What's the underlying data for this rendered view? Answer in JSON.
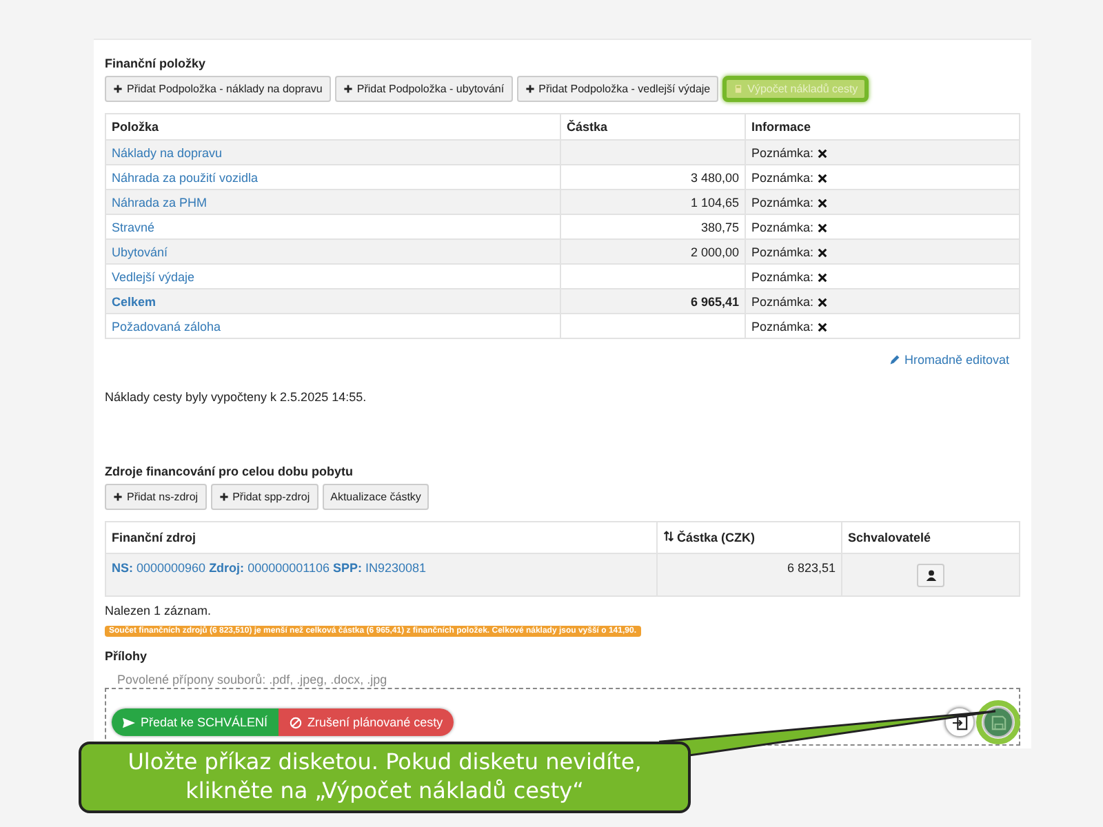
{
  "items_section": {
    "title": "Finanční položky",
    "buttons": [
      {
        "label": "Přidat Podpoložka - náklady na dopravu",
        "kind": "add",
        "highlighted": false
      },
      {
        "label": "Přidat Podpoložka - ubytování",
        "kind": "add",
        "highlighted": false
      },
      {
        "label": "Přidat Podpoložka - vedlejší výdaje",
        "kind": "add",
        "highlighted": false
      },
      {
        "label": "Výpočet nákladů cesty",
        "kind": "calculate",
        "highlighted": true
      }
    ],
    "table": {
      "columns": [
        "Položka",
        "Částka",
        "Informace"
      ],
      "rows": [
        {
          "item": "Náklady na dopravu",
          "amount": "",
          "info": "Poznámka:",
          "bold": false
        },
        {
          "item": "Náhrada za použití vozidla",
          "amount": "3 480,00",
          "info": "Poznámka:",
          "bold": false
        },
        {
          "item": "Náhrada za PHM",
          "amount": "1 104,65",
          "info": "Poznámka:",
          "bold": false
        },
        {
          "item": "Stravné",
          "amount": "380,75",
          "info": "Poznámka:",
          "bold": false
        },
        {
          "item": "Ubytování",
          "amount": "2 000,00",
          "info": "Poznámka:",
          "bold": false
        },
        {
          "item": "Vedlejší výdaje",
          "amount": "",
          "info": "Poznámka:",
          "bold": false
        },
        {
          "item": "Celkem",
          "amount": "6 965,41",
          "info": "Poznámka:",
          "bold": true
        },
        {
          "item": "Požadovaná záloha",
          "amount": "",
          "info": "Poznámka:",
          "bold": false
        }
      ]
    },
    "bulk_edit_link": "Hromadně editovat",
    "calc_note": "Náklady cesty byly vypočteny k 2.5.2025 14:55."
  },
  "funding_section": {
    "title": "Zdroje financování pro celou dobu pobytu",
    "buttons": [
      {
        "label": "Přidat ns-zdroj",
        "kind": "add"
      },
      {
        "label": "Přidat spp-zdroj",
        "kind": "add"
      },
      {
        "label": "Aktualizace částky",
        "kind": "update"
      }
    ],
    "table": {
      "columns": [
        "Finanční zdroj",
        "Částka (CZK)",
        "Schvalovatelé"
      ],
      "rows": [
        {
          "source": "**NS:** 0000000960  **Zdroj:** 000000001106  **SPP:** IN9230081",
          "amount": "6 823,51"
        }
      ]
    },
    "record_count": "Nalezen 1 záznam.",
    "warning": "Součet finančních zdrojů (6 823,510) je menší než celková částka (6 965,41) z finančních položek. Celkové náklady jsou vyšší o 141,90."
  },
  "attachments": {
    "title": "Přílohy",
    "placeholder": "Povolené přípony souborů: .pdf, .jpeg, .docx, .jpg"
  },
  "actions": [
    {
      "label": "Předat ke SCHVÁLENÍ",
      "kind": "submit"
    },
    {
      "label": "Zrušení plánované cesty",
      "kind": "cancel"
    }
  ],
  "icon_actions": [
    {
      "kind": "export",
      "highlighted": false
    },
    {
      "kind": "save",
      "highlighted": true
    }
  ],
  "callout": {
    "text": "Uložte příkaz disketou. Pokud disketu nevidíte, klikněte na „Výpočet nákladů cesty“"
  }
}
